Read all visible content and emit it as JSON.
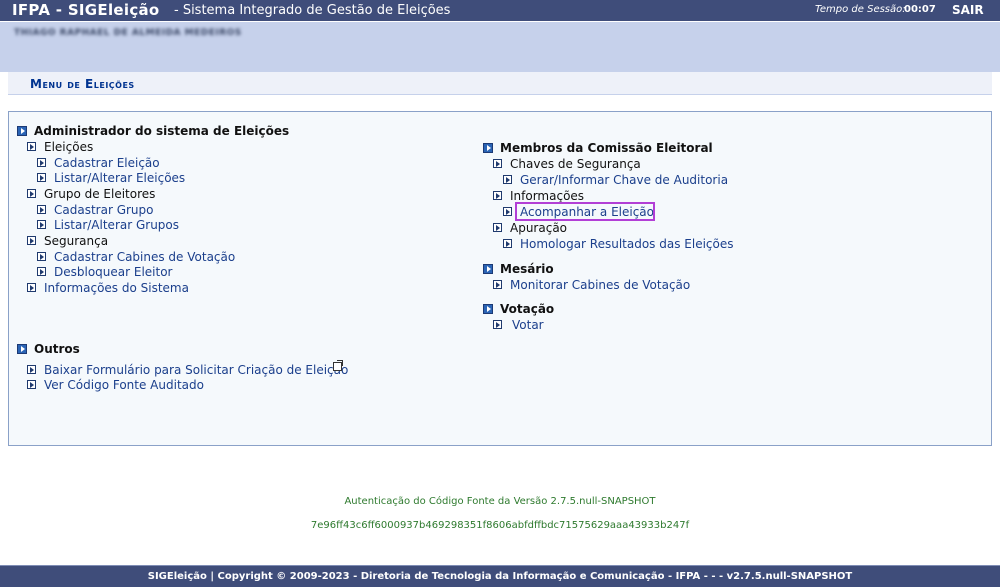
{
  "header": {
    "brand": "IFPA - SIGEleição",
    "subtitle": "- Sistema Integrado de Gestão de Eleições",
    "session_label": "Tempo de Sessão:",
    "session_time": "00:07",
    "logout_label": "SAIR"
  },
  "user": {
    "name": "THIAGO RAPHAEL DE ALMEIDA MEDEIROS"
  },
  "menu_title": "Menu de Eleições",
  "left_column": {
    "admin": {
      "title": "Administrador do sistema de Eleições",
      "eleicoes": {
        "label": "Eleições",
        "items": [
          "Cadastrar Eleição",
          "Listar/Alterar Eleições"
        ]
      },
      "grupo": {
        "label": "Grupo de Eleitores",
        "items": [
          "Cadastrar Grupo",
          "Listar/Alterar Grupos"
        ]
      },
      "seguranca": {
        "label": "Segurança",
        "items": [
          "Cadastrar Cabines de Votação",
          "Desbloquear Eleitor"
        ]
      },
      "info_sistema": "Informações do Sistema"
    },
    "outros": {
      "title": "Outros",
      "items": [
        "Baixar Formulário para Solicitar Criação de Eleição",
        "Ver Código Fonte Auditado"
      ]
    }
  },
  "right_column": {
    "comissao": {
      "title": "Membros da Comissão Eleitoral",
      "chaves": {
        "label": "Chaves de Segurança",
        "items": [
          "Gerar/Informar Chave de Auditoria"
        ]
      },
      "informacoes": {
        "label": "Informações",
        "items": [
          "Acompanhar a Eleição"
        ]
      },
      "apuracao": {
        "label": "Apuração",
        "items": [
          "Homologar Resultados das Eleições"
        ]
      }
    },
    "mesario": {
      "title": "Mesário",
      "items": [
        "Monitorar Cabines de Votação"
      ]
    },
    "votacao": {
      "title": "Votação",
      "items": [
        "Votar"
      ]
    }
  },
  "auth": {
    "line1": "Autenticação do Código Fonte da Versão 2.7.5.null-SNAPSHOT",
    "line2": "7e96ff43c6ff6000937b469298351f8606abfdffbdc71575629aaa43933b247f"
  },
  "footer": {
    "text": "SIGEleição | Copyright © 2009-2023 - Diretoria de Tecnologia da Informação e Comunicação - IFPA - - - v2.7.5.null-SNAPSHOT"
  },
  "colors": {
    "header_bg": "#3f4d7a",
    "user_band": "#c6d1eb",
    "link": "#1b3f8c",
    "highlight": "#b23fd6",
    "auth_text": "#2e7a2e"
  }
}
